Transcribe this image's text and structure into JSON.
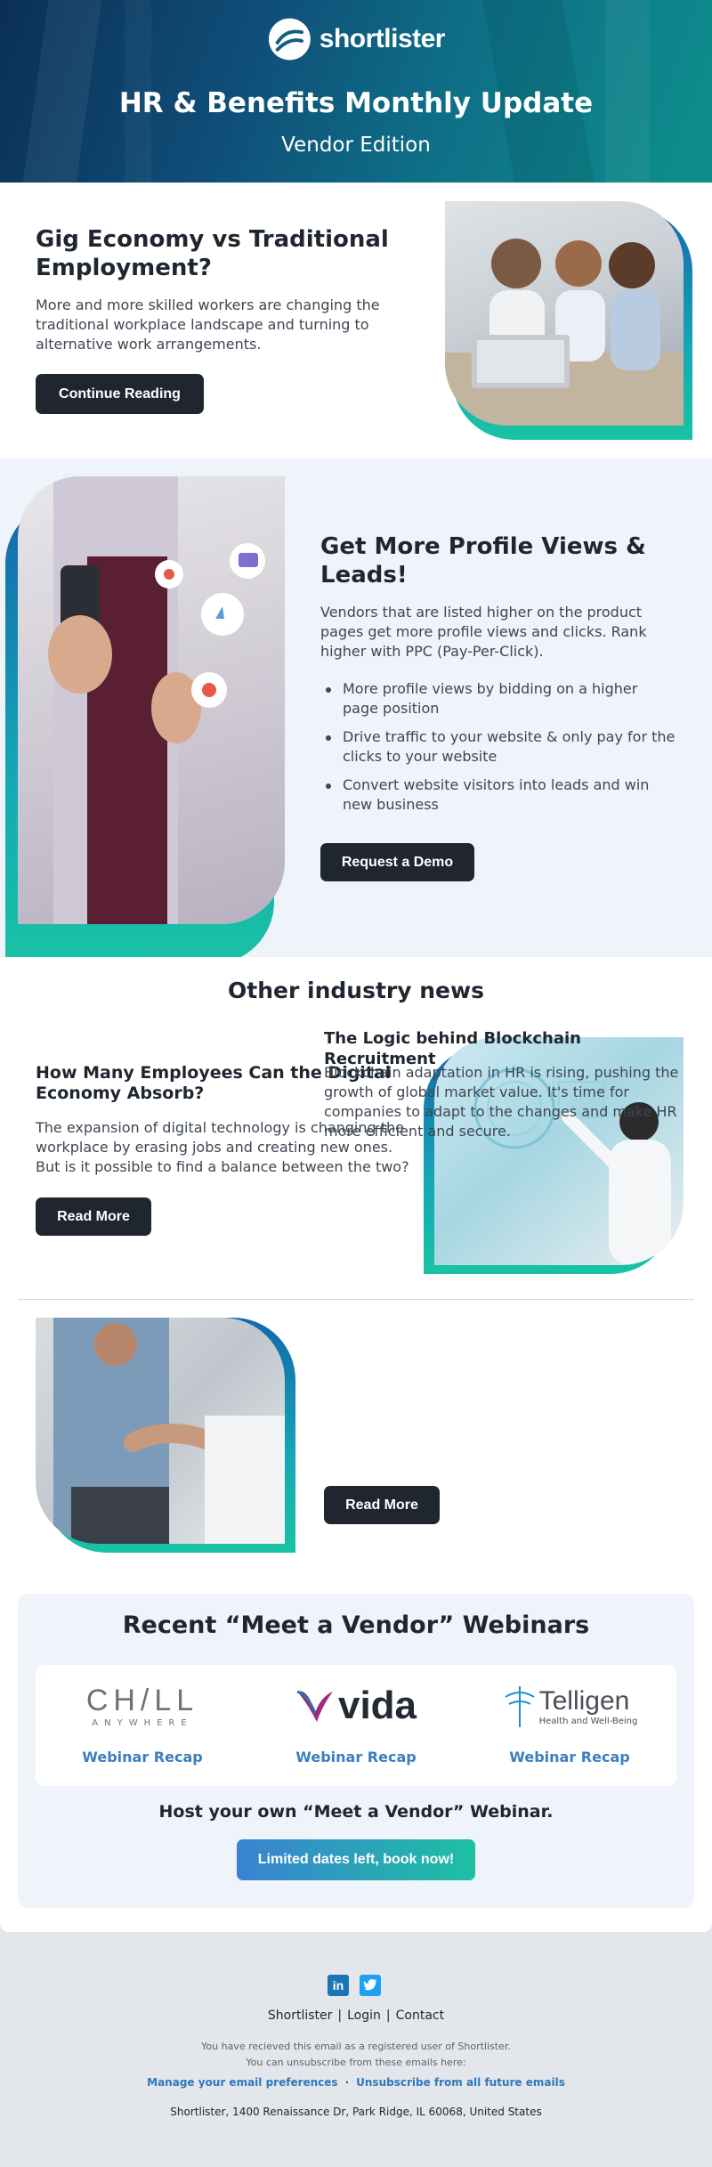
{
  "header": {
    "brand": "shortlister",
    "title": "HR & Benefits Monthly Update",
    "subtitle": "Vendor Edition"
  },
  "feature1": {
    "title": "Gig Economy vs Traditional Employment?",
    "body": "More and more skilled workers are changing the traditional workplace landscape and turning to alternative work arrangements.",
    "button": "Continue Reading"
  },
  "feature2": {
    "title": "Get More Profile Views & Leads!",
    "body": "Vendors that are listed higher on the product pages get more profile views and clicks. Rank higher with PPC (Pay-Per-Click).",
    "bullets": [
      "More profile views by bidding on a higher page position",
      "Drive traffic to your website & only pay for the clicks to your website",
      "Convert website visitors into leads and win new business"
    ],
    "button": "Request a Demo"
  },
  "news": {
    "heading": "Other industry news",
    "items": [
      {
        "title": "How Many Employees Can the Digital Economy Absorb?",
        "body": "The expansion of digital technology is changing the workplace by erasing jobs and creating new ones. But is it possible to find a balance between the two?",
        "button": "Read More"
      },
      {
        "title": "The Logic behind Blockchain Recruitment",
        "body": "Blockchain adaptation in HR is rising, pushing the growth of global market value. It's time for companies to adapt to the changes and make HR more efficient and secure.",
        "button": "Read More"
      }
    ]
  },
  "webinars": {
    "heading": "Recent “Meet a Vendor” Webinars",
    "vendors": [
      {
        "logo_main": "CH/LL",
        "logo_sub": "ANYWHERE",
        "link": "Webinar Recap"
      },
      {
        "logo_main": "vida",
        "link": "Webinar Recap"
      },
      {
        "logo_main": "Telligen",
        "logo_sub": "Health and Well-Being",
        "link": "Webinar Recap"
      }
    ],
    "host_text": "Host your own “Meet a Vendor” Webinar.",
    "cta": "Limited dates left, book now!"
  },
  "footer": {
    "social": [
      {
        "name": "linkedin-icon",
        "glyph": "in"
      },
      {
        "name": "twitter-icon",
        "glyph": "🐦"
      }
    ],
    "links": [
      "Shortlister",
      "Login",
      "Contact"
    ],
    "notice1": "You have recieved this email as a registered user of Shortlister.",
    "notice2": "You can unsubscribe from these emails here:",
    "manage": "Manage your email preferences",
    "unsubscribe": "Unsubscribe from all future emails",
    "address": "Shortlister, 1400 Renaissance Dr, Park Ridge, IL 60068,  United States"
  },
  "colors": {
    "dark": "#1f2630",
    "accent_blue": "#3a7fc0",
    "accent_teal": "#18c3a4",
    "light_bg": "#eef4fa"
  }
}
